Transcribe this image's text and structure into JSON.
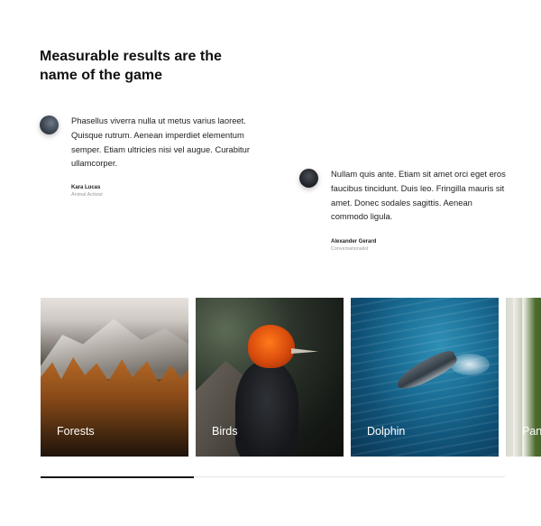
{
  "section": {
    "heading": "Measurable results are the name of the game"
  },
  "testimonials": [
    {
      "quote": "Phasellus viverra nulla ut metus varius laoreet. Quisque rutrum. Aenean imperdiet elementum semper. Etiam ultricies nisi vel augue. Curabitur ullamcorper.",
      "name": "Kara Lucas",
      "role": "Animal Activist"
    },
    {
      "quote": "Nullam quis ante. Etiam sit amet orci eget eros faucibus tincidunt. Duis leo. Fringilla mauris sit amet. Donec sodales sagittis. Aenean commodo ligula.",
      "name": "Alexander Gerard",
      "role": "Conversationalist"
    }
  ],
  "gallery": {
    "cards": [
      {
        "label": "Forests"
      },
      {
        "label": "Birds"
      },
      {
        "label": "Dolphin"
      },
      {
        "label": "Pan"
      }
    ],
    "progress_fraction": 0.33
  },
  "colors": {
    "text": "#111111",
    "muted": "#999999",
    "progress_track": "#e4e4e4",
    "progress_fill": "#111111"
  }
}
